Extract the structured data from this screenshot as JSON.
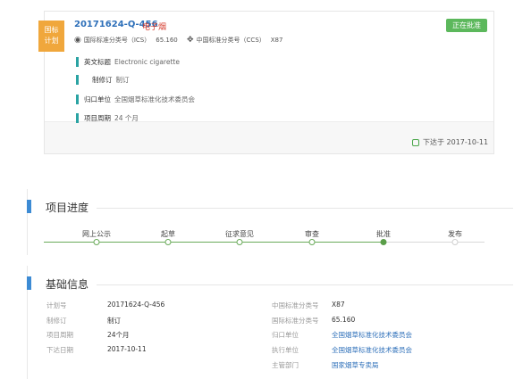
{
  "card": {
    "plan_badge": [
      "国标",
      "计划"
    ],
    "std_no": "20171624-Q-456",
    "std_name": "电子烟",
    "status": "正在批准",
    "ics_label": "国际标准分类号（ICS）",
    "ics_value": "65.160",
    "ccs_label": "中国标准分类号（CCS）",
    "ccs_value": "X87",
    "rows": [
      {
        "label": "英文标题",
        "value": "Electronic cigarette"
      },
      {
        "label": "制修订",
        "value": "制订"
      },
      {
        "label": "归口单位",
        "value": "全国烟草标准化技术委员会"
      },
      {
        "label": "项目周期",
        "value": "24 个月"
      }
    ],
    "issued": "下达于 2017-10-11"
  },
  "progress": {
    "title": "项目进度",
    "steps": [
      "网上公示",
      "起草",
      "征求意见",
      "审查",
      "批准",
      "发布"
    ],
    "current_index": 4
  },
  "basic": {
    "title": "基础信息",
    "left": [
      {
        "label": "计划号",
        "value": "20171624-Q-456"
      },
      {
        "label": "制修订",
        "value": "制订"
      },
      {
        "label": "项目周期",
        "value": "24个月"
      },
      {
        "label": "下达日期",
        "value": "2017-10-11"
      }
    ],
    "right": [
      {
        "label": "中国标准分类号",
        "value": "X87"
      },
      {
        "label": "国际标准分类号",
        "value": "65.160"
      },
      {
        "label": "归口单位",
        "value": "全国烟草标准化技术委员会"
      },
      {
        "label": "执行单位",
        "value": "全国烟草标准化技术委员会"
      },
      {
        "label": "主管部门",
        "value": "国家烟草专卖局"
      }
    ]
  },
  "colors": {
    "accent_blue": "#3d8bd4",
    "link_blue": "#2d6fb9",
    "status_green": "#5cb85c",
    "badge_orange": "#f0a73c",
    "teal_bar": "#2aa3a3",
    "title_red": "#d53a2c"
  },
  "icons": {
    "ics": "globe-icon",
    "ccs": "cross-arrows-icon",
    "issued": "calendar-icon"
  }
}
